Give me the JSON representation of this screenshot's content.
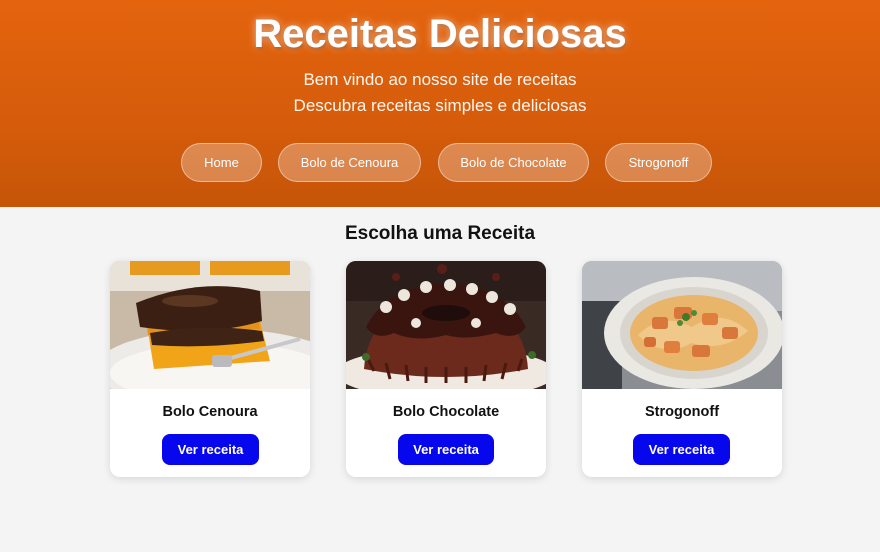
{
  "header": {
    "title": "Receitas Deliciosas",
    "subtitle_1": "Bem vindo ao nosso site de receitas",
    "subtitle_2": "Descubra receitas simples e deliciosas",
    "nav": [
      {
        "label": "Home"
      },
      {
        "label": "Bolo de Cenoura"
      },
      {
        "label": "Bolo de Chocolate"
      },
      {
        "label": "Strogonoff"
      }
    ]
  },
  "main": {
    "section_title": "Escolha uma Receita",
    "recipes": [
      {
        "name": "Bolo Cenoura",
        "button": "Ver receita"
      },
      {
        "name": "Bolo Chocolate",
        "button": "Ver receita"
      },
      {
        "name": "Strogonoff",
        "button": "Ver receita"
      }
    ]
  },
  "colors": {
    "header_orange": "#e4640e",
    "button_blue": "#0707ee",
    "page_bg": "#f4f4f4"
  }
}
